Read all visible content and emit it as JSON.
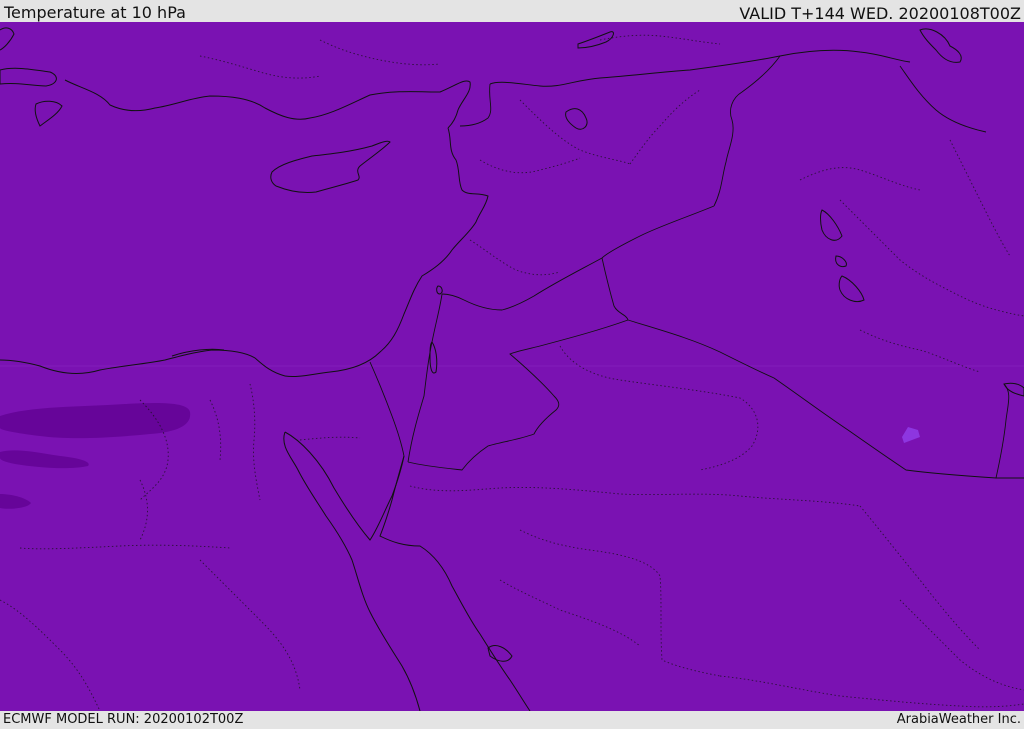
{
  "header": {
    "title": "Temperature at 10 hPa",
    "valid_time": "VALID T+144 WED. 20200108T00Z"
  },
  "footer": {
    "model_run": "ECMWF MODEL RUN: 20200102T00Z",
    "credit": "ArabiaWeather Inc."
  },
  "map": {
    "fill_color": "#7a12b2",
    "cold_contour_color": "#660599",
    "warm_patch_color": "#8d36e0",
    "coastline_color": "#111111",
    "border_color": "#111111"
  }
}
